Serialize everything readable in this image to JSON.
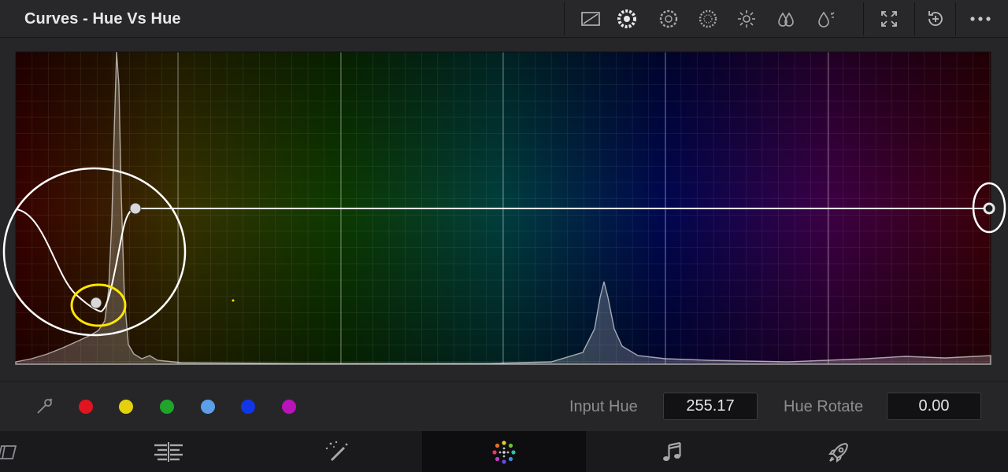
{
  "header": {
    "title": "Curves - Hue Vs Hue",
    "tools": [
      {
        "name": "custom-curve-icon"
      },
      {
        "name": "hue-vs-hue-icon"
      },
      {
        "name": "hue-vs-sat-icon"
      },
      {
        "name": "hue-vs-lum-icon"
      },
      {
        "name": "lum-vs-sat-icon"
      },
      {
        "name": "sat-vs-sat-icon"
      },
      {
        "name": "sat-vs-lum-icon"
      },
      {
        "name": "expand-icon"
      },
      {
        "name": "reset-icon"
      },
      {
        "name": "more-options-icon"
      }
    ]
  },
  "curve": {
    "points": [
      {
        "hue": 0,
        "value": 0.5,
        "state": "normal"
      },
      {
        "hue": 0.083,
        "value": 0.2,
        "state": "selected"
      },
      {
        "hue": 0.123,
        "value": 0.5,
        "state": "normal"
      },
      {
        "hue": 1,
        "value": 0.5,
        "state": "edge"
      }
    ]
  },
  "colors": {
    "accent_select": "#ffe600",
    "curve": "#ffffff",
    "swatch_red": "#e0151f",
    "swatch_yellow": "#e3d10e",
    "swatch_green": "#1ea52a",
    "swatch_cyan": "#5d9ee8",
    "swatch_blue": "#1136e8",
    "swatch_magenta": "#b814b8"
  },
  "controls": {
    "swatches": [
      "red",
      "yellow",
      "green",
      "cyan",
      "blue",
      "magenta"
    ],
    "input_hue_label": "Input Hue",
    "input_hue_value": "255.17",
    "hue_rotate_label": "Hue Rotate",
    "hue_rotate_value": "0.00"
  },
  "nav": {
    "items": [
      {
        "name": "media-page-icon",
        "active": false
      },
      {
        "name": "edit-page-icon",
        "active": false
      },
      {
        "name": "fusion-page-icon",
        "active": false
      },
      {
        "name": "color-page-icon",
        "active": true
      },
      {
        "name": "fairlight-page-icon",
        "active": false
      },
      {
        "name": "deliver-page-icon",
        "active": false
      }
    ]
  }
}
